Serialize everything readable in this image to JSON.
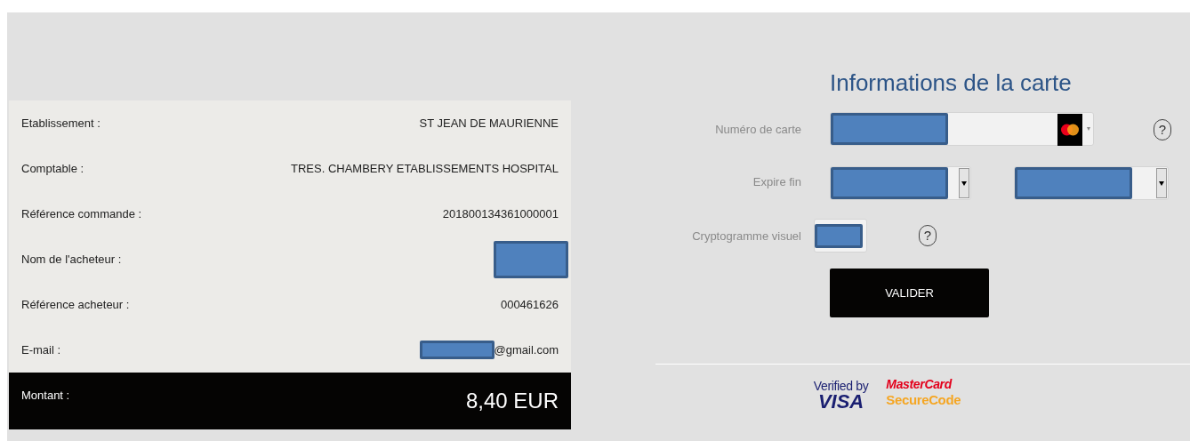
{
  "summary": {
    "rows": [
      {
        "label": "Etablissement :",
        "kind": "text",
        "value": "ST JEAN DE MAURIENNE"
      },
      {
        "label": "Comptable :",
        "kind": "text",
        "value": "TRES. CHAMBERY ETABLISSEMENTS HOSPITAL"
      },
      {
        "label": "Référence commande :",
        "kind": "text",
        "value": "201800134361000001"
      },
      {
        "label": "Nom de l'acheteur :",
        "kind": "redacted"
      },
      {
        "label": "Référence acheteur :",
        "kind": "text",
        "value": "000461626"
      },
      {
        "label": "E-mail :",
        "kind": "partly_redacted",
        "value": "@gmail.com"
      }
    ],
    "amount": {
      "label": "Montant :",
      "value": "8,40 EUR"
    }
  },
  "card_form": {
    "title": "Informations de la carte",
    "fields": [
      {
        "label": "Numéro de carte",
        "kind": "card_number",
        "help": "?"
      },
      {
        "label": "Expire fin",
        "kind": "expiry"
      },
      {
        "label": "Cryptogramme visuel",
        "kind": "cvv",
        "help": "?"
      }
    ],
    "submit": "VALIDER",
    "badges": [
      {
        "kind": "visa",
        "line1": "Verified by",
        "line2": "VISA"
      },
      {
        "kind": "mastercard",
        "line1": "MasterCard",
        "line2": "SecureCode"
      }
    ]
  }
}
